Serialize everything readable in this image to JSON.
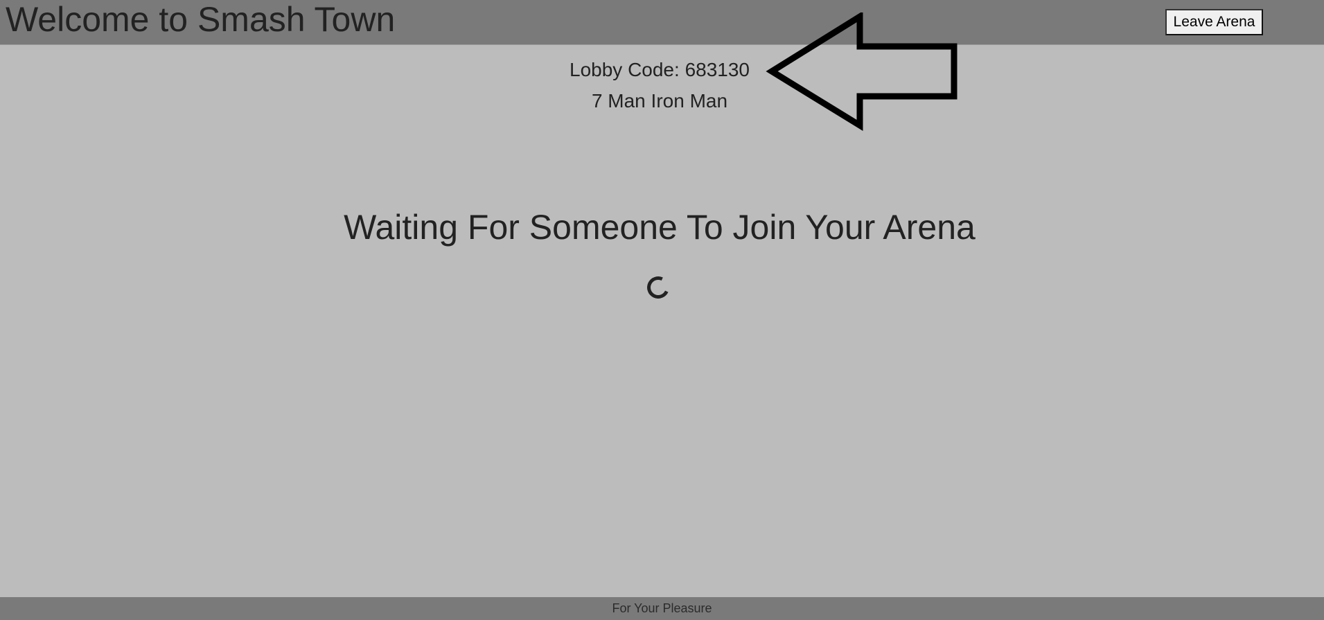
{
  "header": {
    "title": "Welcome to Smash Town",
    "leave_button_label": "Leave Arena"
  },
  "lobby": {
    "code_text": "Lobby Code: 683130",
    "mode_text": "7 Man Iron Man"
  },
  "main": {
    "waiting_text": "Waiting For Someone To Join Your Arena"
  },
  "footer": {
    "text": "For Your Pleasure"
  },
  "icons": {
    "annotation": "left-arrow-icon",
    "loading": "loading-spinner-icon"
  },
  "colors": {
    "header_bg": "#7a7a7a",
    "page_bg": "#bcbcbc",
    "text": "#222222"
  }
}
